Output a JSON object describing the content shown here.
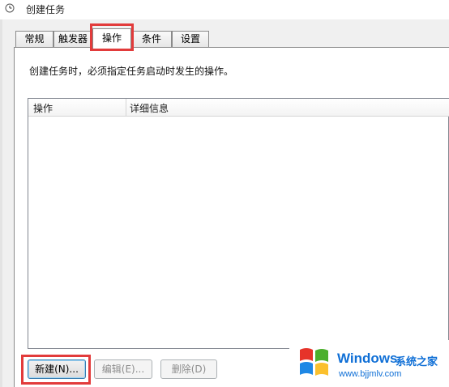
{
  "window": {
    "title": "创建任务",
    "icon": "task-clock-icon"
  },
  "tabs": [
    {
      "label": "常规",
      "active": false
    },
    {
      "label": "触发器",
      "active": false
    },
    {
      "label": "操作",
      "active": true
    },
    {
      "label": "条件",
      "active": false
    },
    {
      "label": "设置",
      "active": false
    }
  ],
  "panel": {
    "instruction": "创建任务时，必须指定任务启动时发生的操作。",
    "list": {
      "columns": [
        "操作",
        "详细信息"
      ],
      "rows": []
    }
  },
  "buttons": {
    "new": {
      "label": "新建(N)...",
      "enabled": true
    },
    "edit": {
      "label": "编辑(E)...",
      "enabled": false
    },
    "delete": {
      "label": "删除(D)",
      "enabled": false
    }
  },
  "highlight_color": "#e23b3b",
  "watermark": {
    "brand": "Windows",
    "cn": "系统之家",
    "url": "www.bjjmlv.com",
    "colors": [
      "#e6332a",
      "#4caf2d",
      "#1e88e5",
      "#fbc02d"
    ]
  }
}
